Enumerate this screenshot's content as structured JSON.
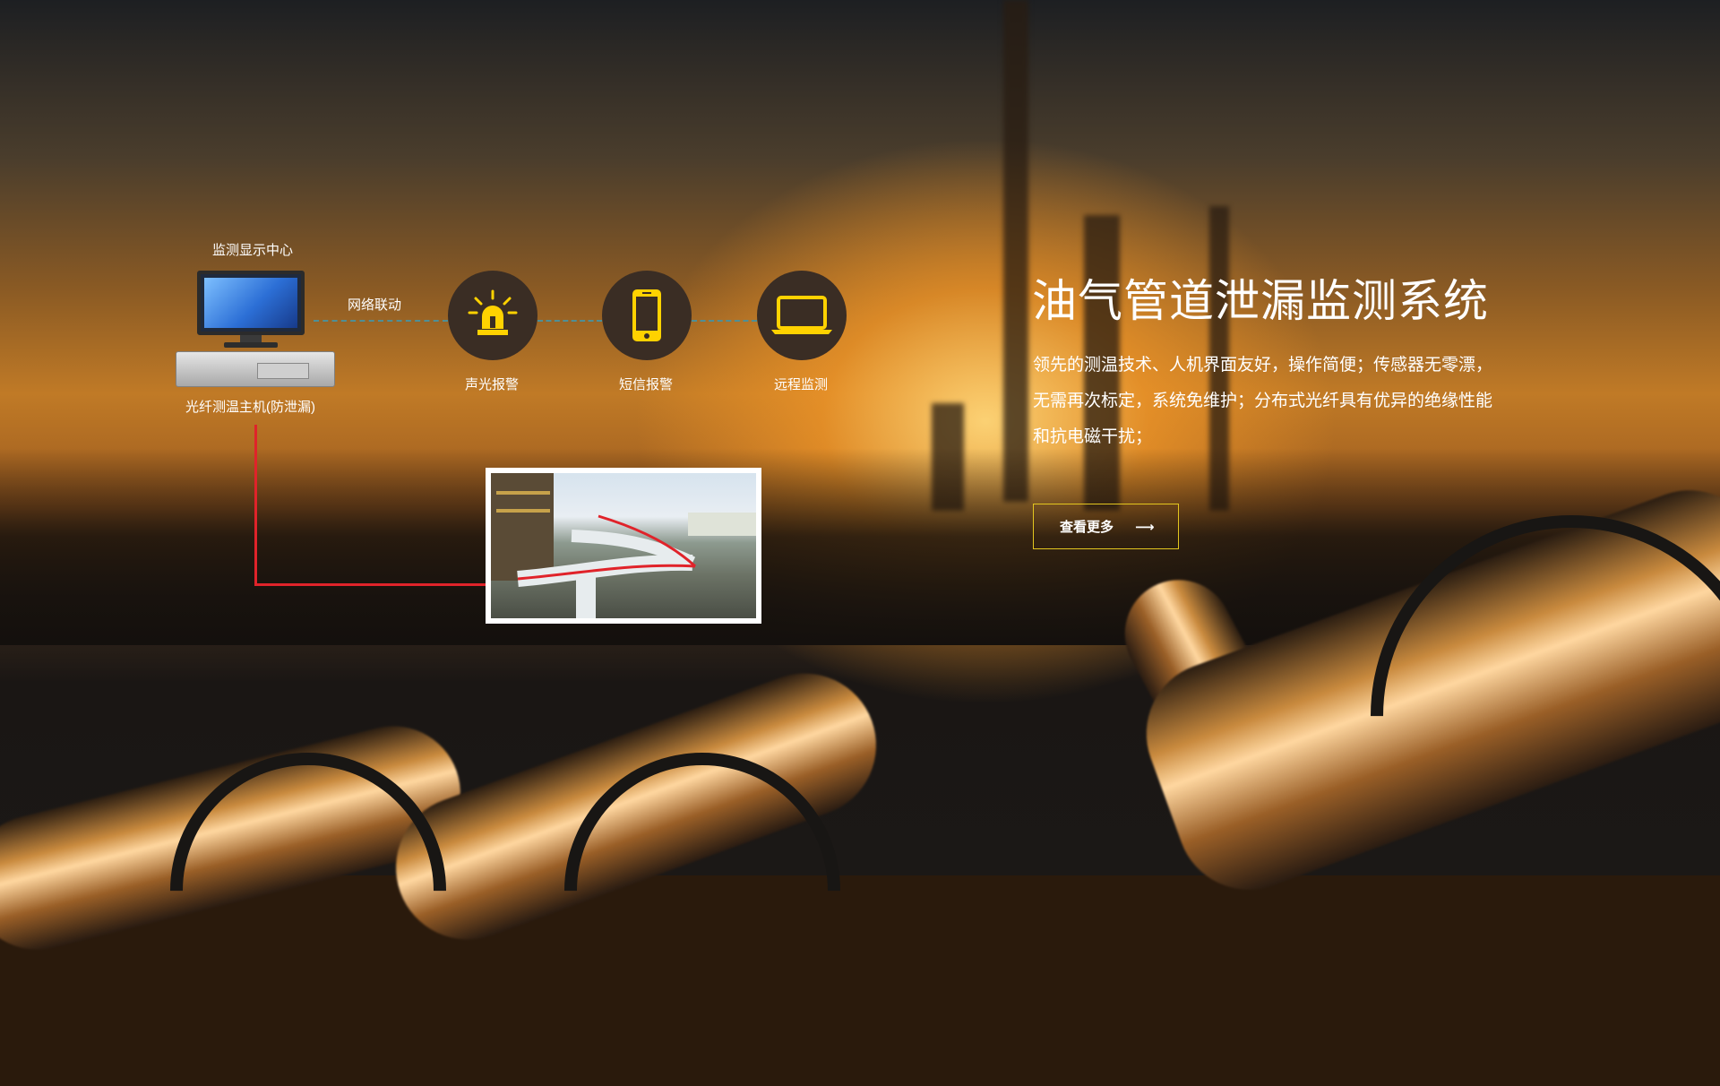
{
  "diagram": {
    "monitor_center_label": "监测显示中心",
    "host_label": "光纤测温主机(防泄漏)",
    "network_label": "网络联动",
    "features": [
      {
        "label": "声光报警",
        "icon": "siren-icon"
      },
      {
        "label": "短信报警",
        "icon": "phone-icon"
      },
      {
        "label": "远程监测",
        "icon": "laptop-icon"
      }
    ]
  },
  "hero": {
    "title": "油气管道泄漏监测系统",
    "description": "领先的测温技术、人机界面友好，操作简便；传感器无零漂，无需再次标定，系统免维护；分布式光纤具有优异的绝缘性能和抗电磁干扰；",
    "more_button": "查看更多",
    "arrow_glyph": "⟶"
  },
  "colors": {
    "accent_yellow": "#ffd200",
    "button_border": "#e3c61f",
    "fiber_red": "#e0232a",
    "dash_teal": "#4f8f96",
    "circle_bg": "#3a2d24"
  }
}
